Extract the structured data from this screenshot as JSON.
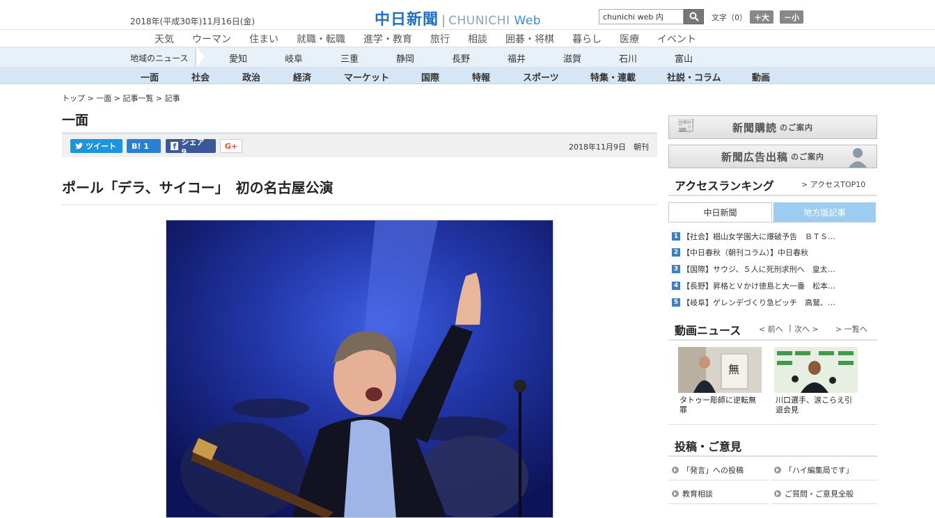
{
  "header": {
    "date": "2018年(平成30年)11月16日(金)",
    "logo_jp": "中日新聞",
    "logo_sep": "|",
    "logo_en_a": "CHUNICHI ",
    "logo_en_b": "Web",
    "search_value": "chunichi web 内",
    "moji_label": "文字（0）",
    "size_up": "＋大",
    "size_down": "－小"
  },
  "nav_main": [
    "天気",
    "ウーマン",
    "住まい",
    "就職・転職",
    "進学・教育",
    "旅行",
    "相談",
    "囲碁・将棋",
    "暮らし",
    "医療",
    "イベント"
  ],
  "nav_region": {
    "label": "地域のニュース",
    "items": [
      "愛知",
      "岐阜",
      "三重",
      "静岡",
      "長野",
      "福井",
      "滋賀",
      "石川",
      "富山"
    ]
  },
  "nav_category": [
    "一面",
    "社会",
    "政治",
    "経済",
    "マーケット",
    "国際",
    "特報",
    "スポーツ",
    "特集・連載",
    "社説・コラム",
    "動画"
  ],
  "breadcrumb": "トップ > 一面 > 記事一覧 > 記事",
  "section_title": "一面",
  "share": {
    "tweet": "ツイート",
    "hatena": "B! 1",
    "facebook": "シェア 9",
    "gplus": "G+"
  },
  "pub_date": "2018年11月9日　朝刊",
  "headline": "ポール「デラ、サイコー」　初の名古屋公演",
  "sidebar": {
    "promo1_main": "新聞購読",
    "promo1_sub": "のご案内",
    "promo2_main": "新聞広告出稿",
    "promo2_sub": "のご案内",
    "ranking_title": "アクセスランキング",
    "ranking_link": "> アクセスTOP10",
    "tab_active": "中日新聞",
    "tab_inactive": "地方版記事",
    "ranking": [
      {
        "num": "1",
        "text": "【社会】椙山女学園大に爆破予告　ＢＴＳ…"
      },
      {
        "num": "2",
        "text": "【中日春秋（朝刊コラム）】中日春秋"
      },
      {
        "num": "3",
        "text": "【国際】サウジ、５人に死刑求刑へ　皇太…"
      },
      {
        "num": "4",
        "text": "【長野】昇格とＶかけ徳島と大一番　松本…"
      },
      {
        "num": "5",
        "text": "【岐阜】ゲレンデづくり急ピッチ　高鷲、…"
      }
    ],
    "video_title": "動画ニュース",
    "video_prev": "< 前へ",
    "video_sep": "|",
    "video_next": "次へ >",
    "video_list": "> 一覧へ",
    "videos": [
      {
        "caption": "タトゥー彫師に逆転無罪"
      },
      {
        "caption": "川口選手、涙こらえ引退会見"
      }
    ],
    "contrib_title": "投稿・ご意見",
    "contrib": [
      "「発言」への投稿",
      "「ハイ編集局です」",
      "教育相談",
      "ご質問・ご意見全般"
    ]
  },
  "colors": {
    "logo_blue": "#1f6fc5",
    "tab_blue": "#9ccdf0",
    "rank_blue": "#3c7fc4"
  }
}
